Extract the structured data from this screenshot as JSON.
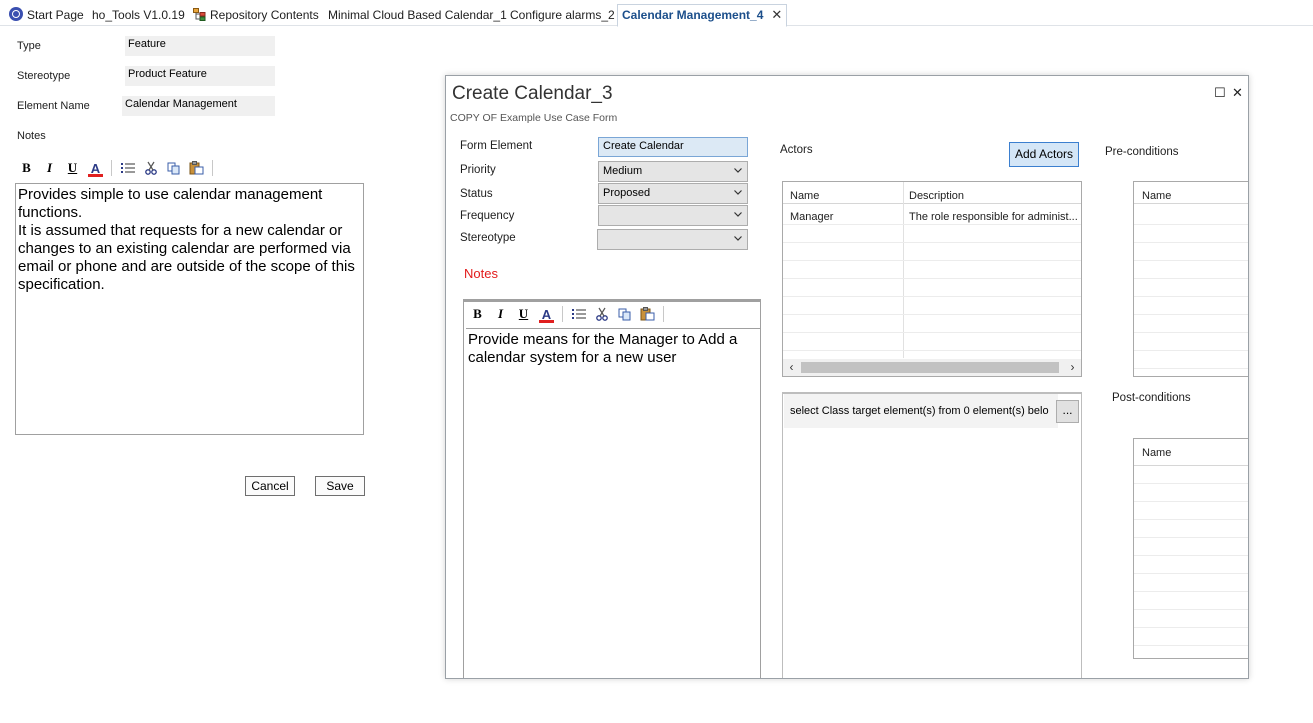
{
  "tabs": [
    {
      "label": "Start Page",
      "icon": "start-page-icon"
    },
    {
      "label": "ho_Tools  V1.0.19"
    },
    {
      "label": "Repository Contents",
      "icon": "repository-icon"
    },
    {
      "label": "Minimal Cloud Based Calendar_1"
    },
    {
      "label": "Configure alarms_2"
    },
    {
      "label": "Calendar Management_4",
      "active": true
    }
  ],
  "tab_close": "✕",
  "element_form": {
    "type_label": "Type",
    "type_value": "Feature",
    "stereotype_label": "Stereotype",
    "stereotype_value": "Product Feature",
    "name_label": "Element Name",
    "name_value": "Calendar Management",
    "notes_label": "Notes",
    "notes_text": "Provides simple to use calendar management functions.\nIt is assumed that requests for a new calendar or changes to an existing calendar are performed via email or phone and are outside of the scope of this specification.",
    "cancel_label": "Cancel",
    "save_label": "Save"
  },
  "toolbar": {
    "bold": "B",
    "italic": "I",
    "underline": "U",
    "font_color": "A",
    "icons": [
      "bold-icon",
      "italic-icon",
      "underline-icon",
      "font-color-icon",
      "bullet-list-icon",
      "cut-icon",
      "copy-icon",
      "paste-icon"
    ]
  },
  "dialog": {
    "title": "Create Calendar_3",
    "subtitle": "COPY OF Example Use Case Form",
    "maximize": "☐",
    "close": "✕",
    "form_element_label": "Form Element",
    "form_element_value": "Create Calendar",
    "priority_label": "Priority",
    "priority_value": "Medium",
    "status_label": "Status",
    "status_value": "Proposed",
    "frequency_label": "Frequency",
    "frequency_value": "",
    "stereotype_label": "Stereotype",
    "stereotype_value": "",
    "notes_label": "Notes",
    "notes_text": "Provide means for the Manager to Add a calendar system for a new user",
    "actors_label": "Actors",
    "add_actors_label": "Add Actors",
    "actors_columns": [
      "Name",
      "Description"
    ],
    "actors_rows": [
      {
        "name": "Manager",
        "description": "The role responsible for administ..."
      }
    ],
    "target_text": "select Class target element(s) from 0 element(s) belo",
    "ellipsis_label": "...",
    "preconditions_label": "Pre-conditions",
    "preconditions_column": "Name",
    "postconditions_label": "Post-conditions",
    "postconditions_column": "Name"
  },
  "colors": {
    "active_tab_text": "#1c4f8b",
    "notes_red": "#e21b1b",
    "add_actors_bg": "#d4e6f7",
    "form_element_bg": "#dce9f5"
  }
}
